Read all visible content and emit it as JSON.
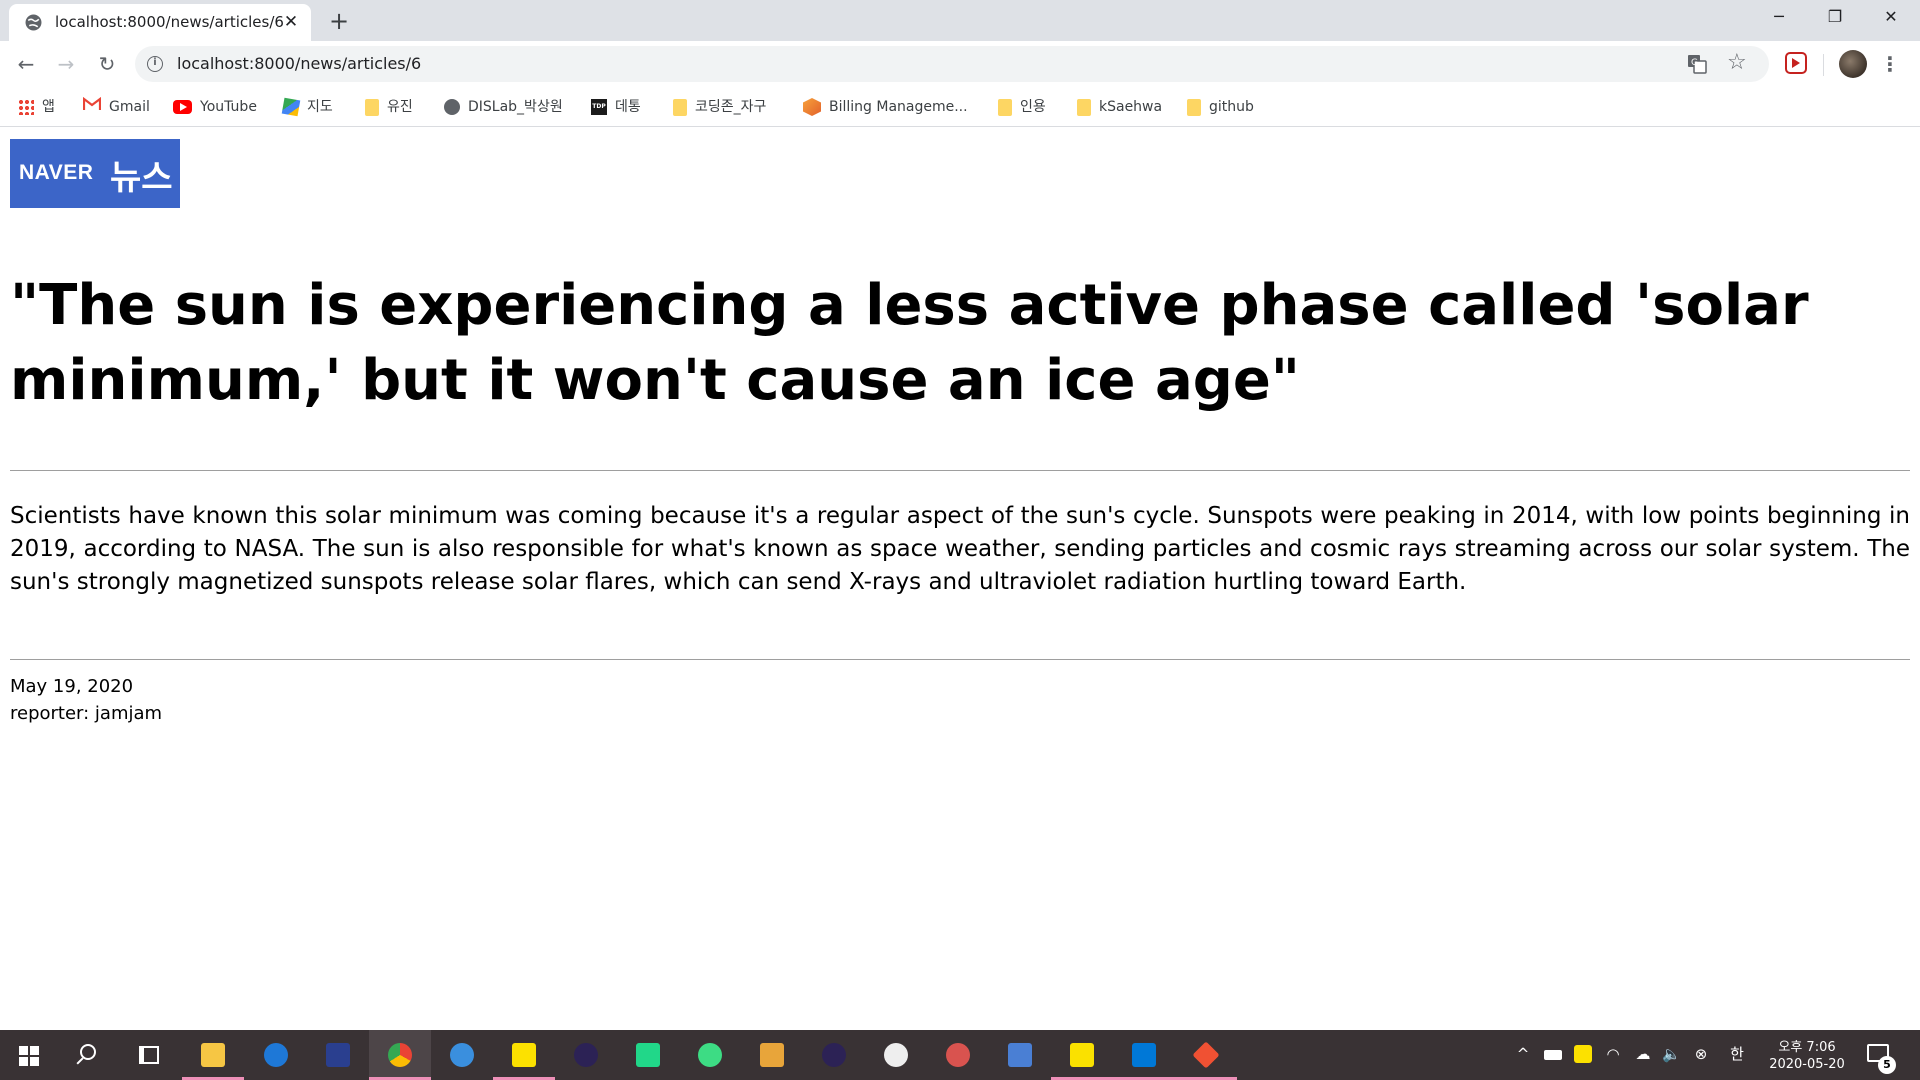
{
  "browser": {
    "tab_title": "localhost:8000/news/articles/6",
    "tab_close_glyph": "✕",
    "new_tab_glyph": "+",
    "window_controls": {
      "minimize": "─",
      "maximize": "❐",
      "close": "✕"
    },
    "nav": {
      "back": "←",
      "forward": "→",
      "reload": "↻"
    },
    "url": "localhost:8000/news/articles/6",
    "info_glyph": "i",
    "star_glyph": "☆",
    "menu_glyph": "⋮",
    "icons": [
      "page-favicon-icon",
      "info-icon",
      "translate-icon",
      "star-icon",
      "extension-icon",
      "profile-avatar",
      "menu-icon"
    ]
  },
  "bookmarks": [
    {
      "label": "앱",
      "icon": "apps-grid-icon"
    },
    {
      "label": "Gmail",
      "icon": "gmail-icon"
    },
    {
      "label": "YouTube",
      "icon": "youtube-icon"
    },
    {
      "label": "지도",
      "icon": "maps-icon"
    },
    {
      "label": "유진",
      "icon": "folder-icon"
    },
    {
      "label": "DISLab_박상원",
      "icon": "globe-icon"
    },
    {
      "label": "데통",
      "icon": "tdp-icon"
    },
    {
      "label": "코딩존_자구",
      "icon": "folder-icon"
    },
    {
      "label": "Billing Manageme...",
      "icon": "billing-cube-icon"
    },
    {
      "label": "인용",
      "icon": "folder-icon"
    },
    {
      "label": "kSaehwa",
      "icon": "folder-icon"
    },
    {
      "label": "github",
      "icon": "folder-icon"
    }
  ],
  "page": {
    "logo": {
      "brand": "NAVER",
      "section": "뉴스",
      "color": "#3c65c8"
    },
    "headline": "\"The sun is experiencing a less active phase called 'solar minimum,' but it won't cause an ice age\"",
    "body": "Scientists have known this solar minimum was coming because it's a regular aspect of the sun's cycle. Sunspots were peaking in 2014, with low points beginning in 2019, according to NASA. The sun is also responsible for what's known as space weather, sending particles and cosmic rays streaming across our solar system. The sun's strongly magnetized sunspots release solar flares, which can send X-rays and ultraviolet radiation hurtling toward Earth.",
    "date": "May 19, 2020",
    "reporter": "reporter: jamjam"
  },
  "taskbar": {
    "apps": [
      "file-explorer-icon",
      "edge-icon",
      "devcpp-icon",
      "chrome-icon",
      "internet-explorer-icon",
      "sticky-notes-icon",
      "eclipse-icon",
      "pycharm-icon",
      "android-studio-icon",
      "network-icon",
      "eclipse-icon-2",
      "app-icon",
      "paint-icon",
      "remote-icon",
      "kakaotalk-icon",
      "vscode-icon",
      "git-icon"
    ],
    "active_app": "chrome-icon",
    "tray": {
      "chevron": "^",
      "ime": "한",
      "volume": "🔈"
    },
    "clock_time": "오후 7:06",
    "clock_date": "2020-05-20",
    "notification_count": "5"
  }
}
